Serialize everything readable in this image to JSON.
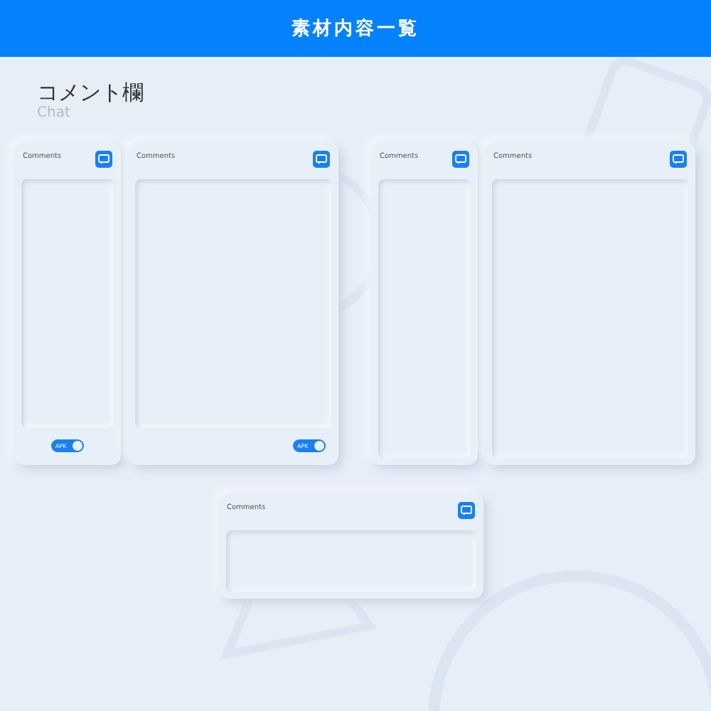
{
  "header": {
    "title": "素材内容一覧"
  },
  "heading": {
    "title": "コメント欄",
    "subtitle": "Chat"
  },
  "card_groups": [
    {
      "cards": [
        {
          "title": "Comments",
          "kind": "narrow",
          "toggle": {
            "label": "APK",
            "on": true
          }
        },
        {
          "title": "Comments",
          "kind": "wide",
          "toggle": {
            "label": "APK",
            "on": true
          }
        }
      ]
    },
    {
      "cards": [
        {
          "title": "Comments",
          "kind": "narrow"
        },
        {
          "title": "Comments",
          "kind": "wide"
        }
      ]
    },
    {
      "cards": [
        {
          "title": "Comments",
          "kind": "landscape"
        }
      ]
    }
  ]
}
